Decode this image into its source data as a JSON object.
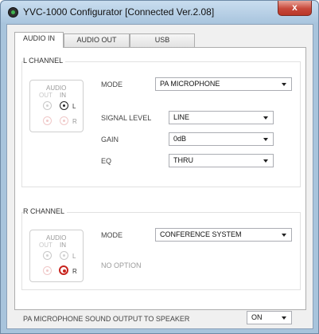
{
  "window": {
    "title": "YVC-1000 Configurator  [Connected  Ver.2.08]",
    "close_label": "x"
  },
  "tabs": [
    {
      "label": "AUDIO IN",
      "active": true
    },
    {
      "label": "AUDIO OUT",
      "active": false
    },
    {
      "label": "USB",
      "active": false
    }
  ],
  "l_channel": {
    "group_title": "L CHANNEL",
    "audio_box": {
      "title": "AUDIO",
      "out": "OUT",
      "in": "IN",
      "l": "L",
      "r": "R"
    },
    "mode_label": "MODE",
    "mode_value": "PA MICROPHONE",
    "signal_level_label": "SIGNAL LEVEL",
    "signal_level_value": "LINE",
    "gain_label": "GAIN",
    "gain_value": "0dB",
    "eq_label": "EQ",
    "eq_value": "THRU"
  },
  "r_channel": {
    "group_title": "R CHANNEL",
    "audio_box": {
      "title": "AUDIO",
      "out": "OUT",
      "in": "IN",
      "l": "L",
      "r": "R"
    },
    "mode_label": "MODE",
    "mode_value": "CONFERENCE SYSTEM",
    "no_option": "NO OPTION"
  },
  "footer": {
    "label": "PA MICROPHONE SOUND OUTPUT TO SPEAKER",
    "value": "ON"
  },
  "colors": {
    "active_jack": "#222222",
    "red_jack": "#c8231d",
    "close_button": "#c7483a"
  }
}
